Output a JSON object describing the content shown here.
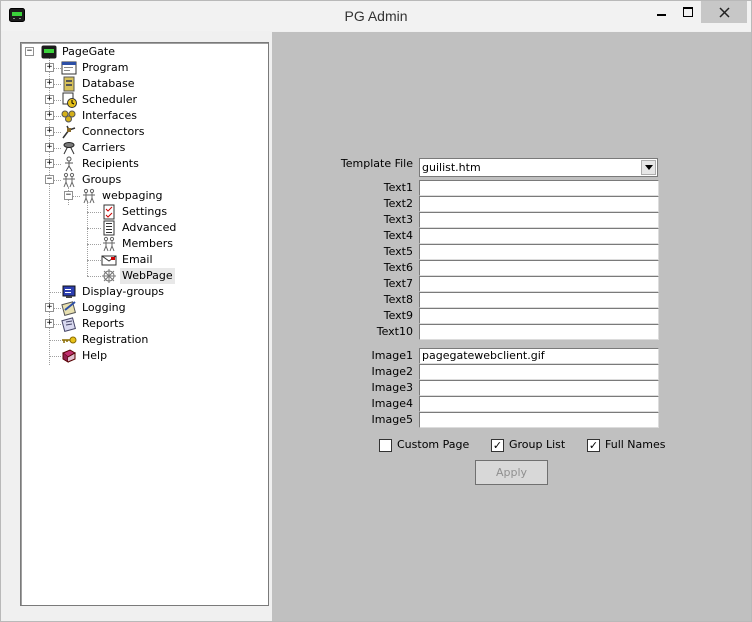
{
  "window": {
    "title": "PG Admin"
  },
  "tree": {
    "root": "PageGate",
    "items": [
      {
        "label": "Program",
        "icon": "program-icon"
      },
      {
        "label": "Database",
        "icon": "database-icon"
      },
      {
        "label": "Scheduler",
        "icon": "scheduler-icon"
      },
      {
        "label": "Interfaces",
        "icon": "interfaces-icon"
      },
      {
        "label": "Connectors",
        "icon": "connectors-icon"
      },
      {
        "label": "Carriers",
        "icon": "carriers-icon"
      },
      {
        "label": "Recipients",
        "icon": "recipients-icon"
      },
      {
        "label": "Groups",
        "icon": "groups-icon"
      },
      {
        "label": "webpaging",
        "icon": "group-icon"
      },
      {
        "label": "Settings",
        "icon": "settings-icon"
      },
      {
        "label": "Advanced",
        "icon": "advanced-icon"
      },
      {
        "label": "Members",
        "icon": "members-icon"
      },
      {
        "label": "Email",
        "icon": "email-icon"
      },
      {
        "label": "WebPage",
        "icon": "webpage-icon"
      },
      {
        "label": "Display-groups",
        "icon": "display-groups-icon"
      },
      {
        "label": "Logging",
        "icon": "logging-icon"
      },
      {
        "label": "Reports",
        "icon": "reports-icon"
      },
      {
        "label": "Registration",
        "icon": "key-icon"
      },
      {
        "label": "Help",
        "icon": "help-book-icon"
      }
    ],
    "selected": "WebPage"
  },
  "form": {
    "template_label": "Template File",
    "template_value": "guilist.htm",
    "text_labels": [
      "Text1",
      "Text2",
      "Text3",
      "Text4",
      "Text5",
      "Text6",
      "Text7",
      "Text8",
      "Text9",
      "Text10"
    ],
    "text_values": [
      "",
      "",
      "",
      "",
      "",
      "",
      "",
      "",
      "",
      ""
    ],
    "image_labels": [
      "Image1",
      "Image2",
      "Image3",
      "Image4",
      "Image5"
    ],
    "image_values": [
      "pagegatewebclient.gif",
      "",
      "",
      "",
      ""
    ],
    "checkboxes": [
      {
        "label": "Custom Page",
        "checked": false,
        "mark": ""
      },
      {
        "label": "Group List",
        "checked": true,
        "mark": "✓"
      },
      {
        "label": "Full Names",
        "checked": true,
        "mark": "✓"
      }
    ],
    "apply_label": "Apply"
  }
}
